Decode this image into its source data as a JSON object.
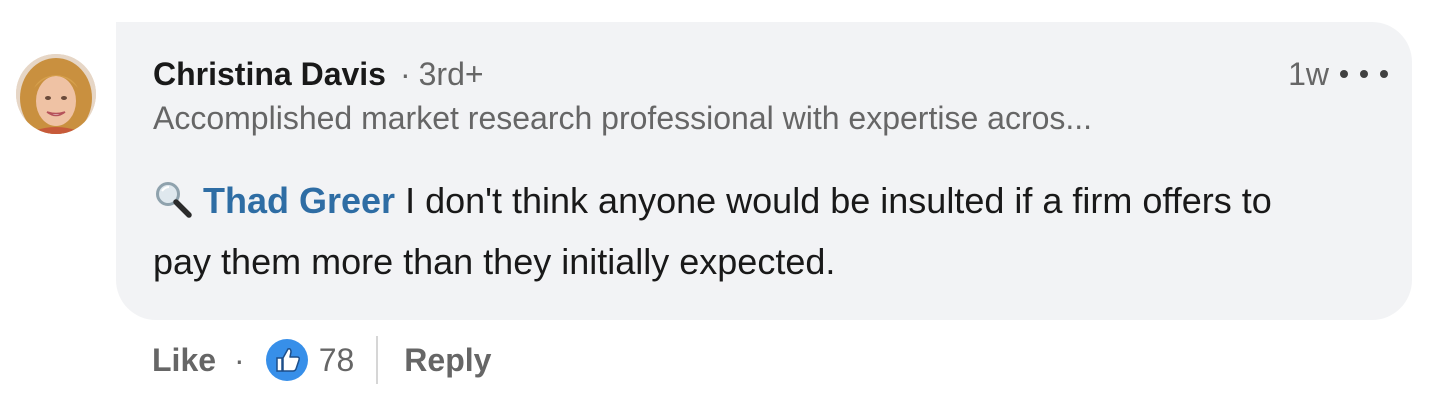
{
  "comment": {
    "author": {
      "name": "Christina Davis",
      "degree": "3rd+",
      "headline": "Accomplished market research professional with expertise acros..."
    },
    "timestamp": "1w",
    "mention": "Thad Greer",
    "text": " I don't think anyone would be insulted if a firm offers to pay them more than they initially expected."
  },
  "actions": {
    "like_label": "Like",
    "separator": "·",
    "reaction_count": "78",
    "reply_label": "Reply"
  },
  "colors": {
    "bubble_bg": "#f2f3f5",
    "mention": "#2e6da4",
    "like_reaction": "#378fe9",
    "text_primary": "#191919",
    "text_secondary": "#666666"
  },
  "icons": {
    "avatar": "avatar",
    "search": "magnifying-glass-icon",
    "more": "more-options-icon",
    "like_reaction": "thumbs-up-icon"
  }
}
